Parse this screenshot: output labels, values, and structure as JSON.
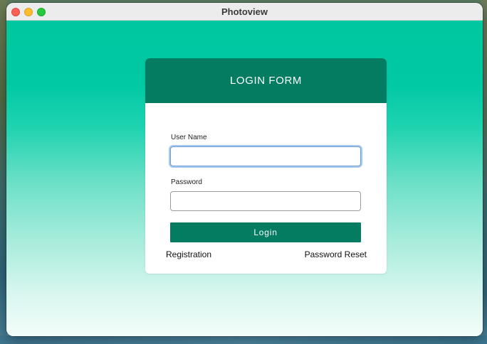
{
  "window": {
    "title": "Photoview"
  },
  "login_form": {
    "header": "LOGIN FORM",
    "username_label": "User Name",
    "username_value": "",
    "password_label": "Password",
    "password_value": "",
    "login_button": "Login",
    "registration_link": "Registration",
    "password_reset_link": "Password Reset"
  },
  "colors": {
    "accent": "#047c61",
    "gradient_top": "#00c7a0",
    "gradient_bottom": "#f4fdfa",
    "focus_ring": "#a9c8ee"
  }
}
